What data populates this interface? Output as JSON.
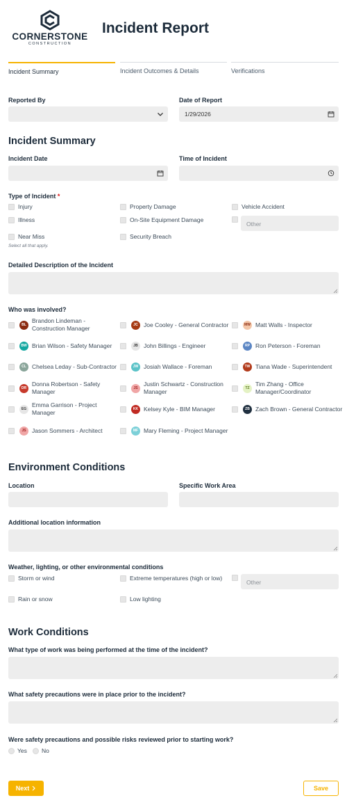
{
  "brand": {
    "name": "CORNERSTONE",
    "sub": "CONSTRUCTION",
    "color": "#1c2b3a"
  },
  "accent": "#f6b300",
  "page_title": "Incident Report",
  "tabs": [
    {
      "label": "Incident Summary",
      "active": true
    },
    {
      "label": "Incident Outcomes & Details",
      "active": false
    },
    {
      "label": "Verifications",
      "active": false
    }
  ],
  "reported_by": {
    "label": "Reported By",
    "value": ""
  },
  "date_of_report": {
    "label": "Date of Report",
    "value": "1/29/2026"
  },
  "summary_heading": "Incident Summary",
  "incident_date": {
    "label": "Incident Date",
    "value": ""
  },
  "time_of_incident": {
    "label": "Time of Incident",
    "value": ""
  },
  "type_of_incident": {
    "label": "Type of Incident",
    "required_mark": "*",
    "options": [
      "Injury",
      "Property Damage",
      "Vehicle Accident",
      "Illness",
      "On-Site Equipment Damage",
      "Near Miss",
      "Security Breach"
    ],
    "other_placeholder": "Other",
    "hint": "Select all that apply."
  },
  "description": {
    "label": "Detailed Description of the Incident"
  },
  "involved": {
    "label": "Who was involved?",
    "people": [
      {
        "initials": "BL",
        "name": "Brandon Lindeman - Construction Manager",
        "color": "#8b2a10"
      },
      {
        "initials": "JC",
        "name": "Joe Cooley - General Contractor",
        "color": "#a63a12"
      },
      {
        "initials": "MW",
        "name": "Matt Walls - Inspector",
        "color": "#f3c6a8"
      },
      {
        "initials": "BW",
        "name": "Brian Wilson - Safety Manager",
        "color": "#13a7a0"
      },
      {
        "initials": "JB",
        "name": "John Billings - Engineer",
        "color": "#e6e6e6"
      },
      {
        "initials": "RP",
        "name": "Ron Peterson - Foreman",
        "color": "#5b86c4"
      },
      {
        "initials": "CL",
        "name": "Chelsea Leday - Sub-Contractor",
        "color": "#8aa59a"
      },
      {
        "initials": "JW",
        "name": "Josiah Wallace - Foreman",
        "color": "#5bc3c8"
      },
      {
        "initials": "TW",
        "name": "Tiana Wade - Superintendent",
        "color": "#b23b1c"
      },
      {
        "initials": "DR",
        "name": "Donna Robertson - Safety Manager",
        "color": "#c73a2c"
      },
      {
        "initials": "JS",
        "name": "Justin Schwartz - Construction Manager",
        "color": "#f0a6a6"
      },
      {
        "initials": "TZ",
        "name": "Tim Zhang - Office Manager/Coordinator",
        "color": "#e4f2c4"
      },
      {
        "initials": "EG",
        "name": "Emma Garrison - Project Manager",
        "color": "#e6e6e6"
      },
      {
        "initials": "KK",
        "name": "Kelsey Kyle - BIM Manager",
        "color": "#c02a22"
      },
      {
        "initials": "ZB",
        "name": "Zach Brown - General Contractor",
        "color": "#203040"
      },
      {
        "initials": "JS",
        "name": "Jason Sommers - Architect",
        "color": "#f0a6a6"
      },
      {
        "initials": "MF",
        "name": "Mary Fleming - Project Manager",
        "color": "#7cd0d8"
      }
    ]
  },
  "env_heading": "Environment Conditions",
  "location": {
    "label": "Location"
  },
  "work_area": {
    "label": "Specific Work Area"
  },
  "additional_location": {
    "label": "Additional location information"
  },
  "weather": {
    "label": "Weather, lighting, or other environmental conditions",
    "options": [
      "Storm or wind",
      "Extreme temperatures (high or low)",
      "Rain or snow",
      "Low lighting"
    ],
    "other_placeholder": "Other"
  },
  "work_heading": "Work Conditions",
  "work_type": {
    "label": "What type of work was being performed at the time of the incident?"
  },
  "precautions": {
    "label": "What safety precautions were in place prior to the incident?"
  },
  "reviewed": {
    "label": "Were safety precautions and possible risks reviewed prior to starting work?",
    "options": [
      "Yes",
      "No"
    ]
  },
  "buttons": {
    "next": "Next",
    "save": "Save"
  }
}
